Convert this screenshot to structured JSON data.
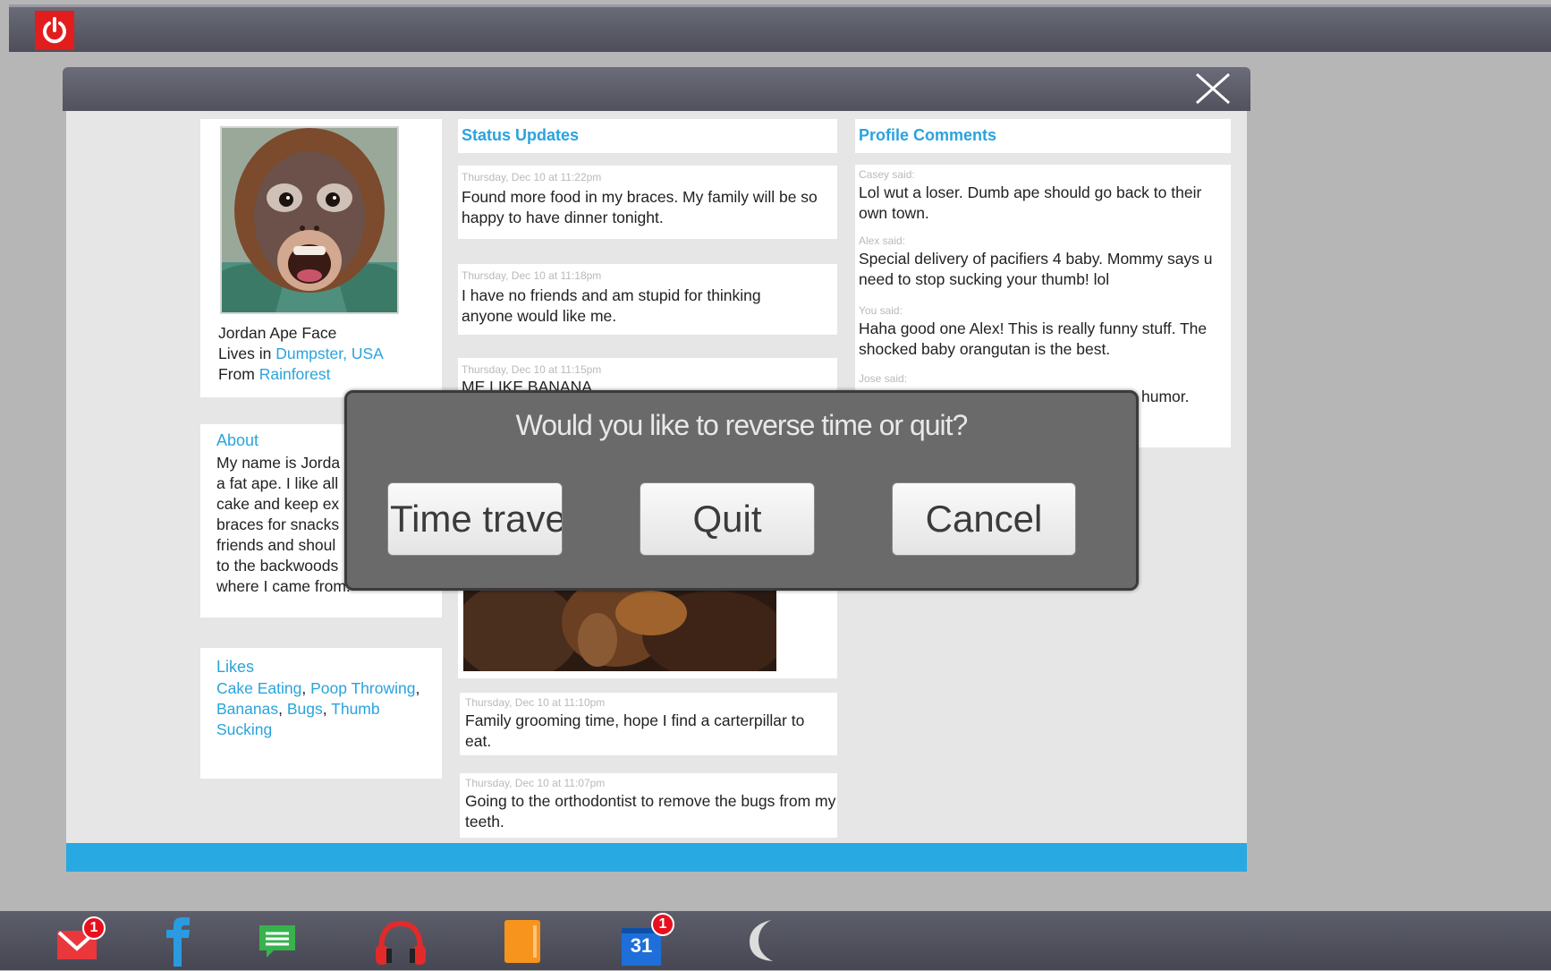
{
  "profile": {
    "name": "Jordan Ape Face",
    "lives_prefix": "Lives in ",
    "lives_value": "Dumpster, USA",
    "from_prefix": "From ",
    "from_value": "Rainforest"
  },
  "about": {
    "heading": "About",
    "lines": [
      "My name is Jorda",
      "a fat ape. I like all",
      "cake and keep ex",
      "braces for snacks",
      "friends and shoul",
      "to the backwoods",
      "where I came from."
    ]
  },
  "likes": {
    "heading": "Likes",
    "items": [
      "Cake Eating",
      "Poop Throwing",
      "Bananas",
      "Bugs",
      "Thumb Sucking"
    ],
    "separator": ", "
  },
  "status": {
    "heading": "Status Updates",
    "posts": [
      {
        "time": "Thursday, Dec 10 at 11:22pm",
        "text": "Found more food in my braces. My family will be so happy to have dinner tonight."
      },
      {
        "time": "Thursday, Dec 10 at 11:18pm",
        "text": "I have no friends and am stupid for thinking anyone would like me."
      },
      {
        "time": "Thursday, Dec 10 at 11:15pm",
        "text": "ME LIKE BANANA"
      },
      {
        "time": "Thursday, Dec 10 at 11:10pm",
        "text": "Family grooming time, hope I find a carterpillar to eat."
      },
      {
        "time": "Thursday, Dec 10 at 11:07pm",
        "text": "Going to the orthodontist to remove the bugs from my teeth."
      }
    ]
  },
  "comments": {
    "heading": "Profile Comments",
    "items": [
      {
        "author": "Casey said:",
        "text": "Lol wut a loser. Dumb ape should go back to their own town."
      },
      {
        "author": "Alex said:",
        "text": "Special delivery of pacifiers 4 baby. Mommy says u need to stop sucking your thumb! lol"
      },
      {
        "author": "You said:",
        "text": "Haha good one Alex! This is really funny stuff. The shocked baby orangutan is the best."
      },
      {
        "author": "Jose said:",
        "text": "humor."
      }
    ]
  },
  "dialog": {
    "title": "Would you like to reverse time or quit?",
    "buttons": [
      "Time travel",
      "Quit",
      "Cancel"
    ]
  },
  "taskbar": {
    "mail_badge": "1",
    "calendar_day": "31",
    "calendar_badge": "1"
  }
}
